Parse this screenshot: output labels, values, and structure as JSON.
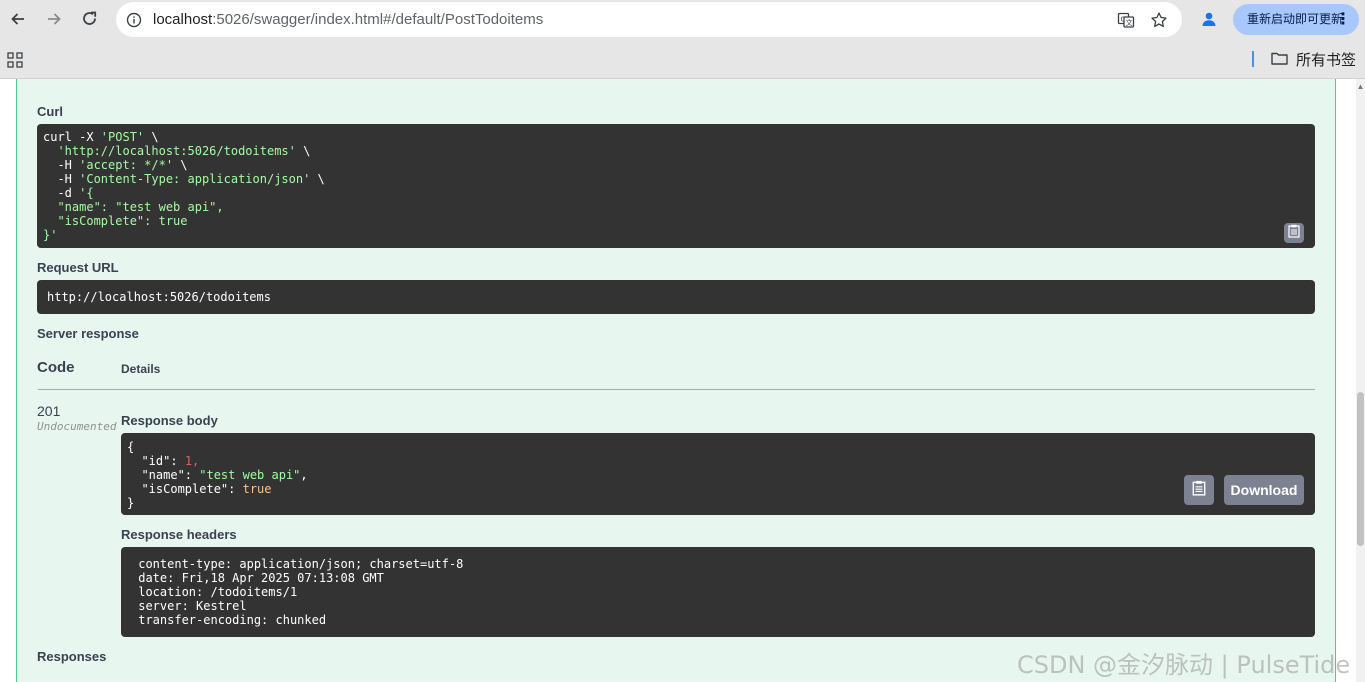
{
  "browser": {
    "url_host": "localhost",
    "url_rest": ":5026/swagger/index.html#/default/PostTodoitems",
    "update_button_label": "重新启动即可更新",
    "all_bookmarks_label": "所有书签"
  },
  "sections": {
    "curl_label": "Curl",
    "request_url_label": "Request URL",
    "server_response_label": "Server response",
    "code_header": "Code",
    "details_header": "Details",
    "response_body_label": "Response body",
    "response_headers_label": "Response headers",
    "responses_label": "Responses"
  },
  "curl": {
    "line1_cmd": "curl -X ",
    "line1_method": "'POST'",
    "line1_end": " \\",
    "line2_url": "  'http://localhost:5026/todoitems'",
    "line2_end": " \\",
    "line3_flag": "  -H ",
    "line3_val": "'accept: */*'",
    "line3_end": " \\",
    "line4_flag": "  -H ",
    "line4_val": "'Content-Type: application/json'",
    "line4_end": " \\",
    "line5_flag": "  -d ",
    "line5_val": "'{",
    "line6": "  \"name\": \"test web api\",",
    "line7": "  \"isComplete\": true",
    "line8": "}'"
  },
  "request_url": "http://localhost:5026/todoitems",
  "response": {
    "status_code": "201",
    "status_note": "Undocumented",
    "body_open": "{",
    "id_key": "  \"id\"",
    "id_val": "1",
    "name_key": "  \"name\"",
    "name_val": "\"test web api\"",
    "complete_key": "  \"isComplete\"",
    "complete_val": "true",
    "body_close": "}",
    "download_label": "Download",
    "headers": [
      " content-type: application/json; charset=utf-8",
      " date: Fri,18 Apr 2025 07:13:08 GMT",
      " location: /todoitems/1",
      " server: Kestrel",
      " transfer-encoding: chunked"
    ]
  },
  "watermark": "CSDN @金汐脉动 | PulseTide",
  "colors": {
    "opblock_bg": "#e8f6f0",
    "opblock_border": "#49cc90",
    "code_bg": "#333333",
    "string": "#a2fca2",
    "number": "#d36363",
    "keyword": "#fcc28c",
    "button_grey": "#7d8293",
    "update_button_bg": "#a8c7fa"
  },
  "icons": [
    "back-icon",
    "forward-icon",
    "reload-icon",
    "site-info-icon",
    "translate-icon",
    "star-icon",
    "profile-icon",
    "apps-icon",
    "folder-icon",
    "copy-icon"
  ]
}
